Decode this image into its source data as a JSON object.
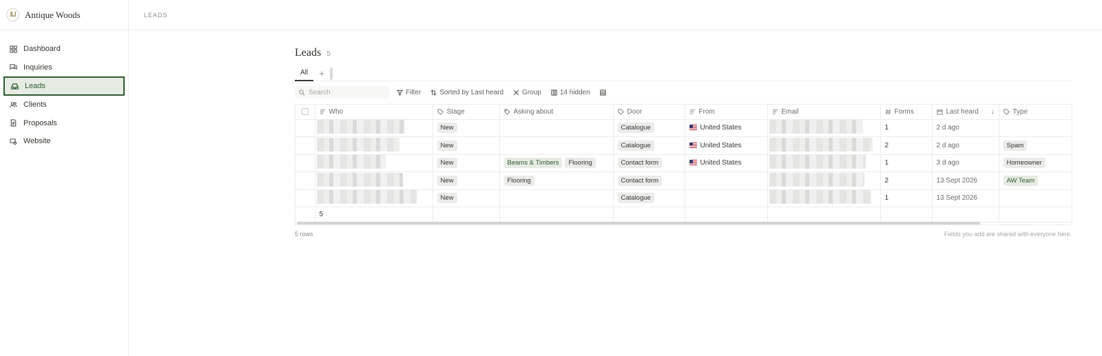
{
  "brand": {
    "logo_text": "IᏓI",
    "name": "Antique Woods"
  },
  "sidebar": {
    "items": [
      {
        "label": "Dashboard",
        "icon": "grid-icon"
      },
      {
        "label": "Inquiries",
        "icon": "chat-icon"
      },
      {
        "label": "Leads",
        "icon": "inbox-icon",
        "active": true
      },
      {
        "label": "Clients",
        "icon": "users-icon"
      },
      {
        "label": "Proposals",
        "icon": "document-icon"
      },
      {
        "label": "Website",
        "icon": "browser-icon"
      }
    ]
  },
  "topbar": {
    "breadcrumb": "LEADS"
  },
  "page": {
    "title": "Leads",
    "count": "5"
  },
  "views": {
    "tabs": [
      {
        "label": "All",
        "active": true
      }
    ],
    "add_label": "+"
  },
  "toolbar": {
    "search_placeholder": "Search",
    "filter_label": "Filter",
    "sort_label": "Sorted by Last heard",
    "group_label": "Group",
    "hidden_label": "14 hidden"
  },
  "table": {
    "columns": [
      "Who",
      "Stage",
      "Asking about",
      "Door",
      "From",
      "Email",
      "Forms",
      "Last heard",
      "Type"
    ],
    "rows": [
      {
        "stage": "New",
        "asking": [],
        "door": "Catalogue",
        "from": "United States",
        "forms": "1",
        "last_heard": "2 d ago",
        "type": ""
      },
      {
        "stage": "New",
        "asking": [],
        "door": "Catalogue",
        "from": "United States",
        "forms": "2",
        "last_heard": "2 d ago",
        "type": "Spam"
      },
      {
        "stage": "New",
        "asking": [
          "Beams & Timbers",
          "Flooring"
        ],
        "door": "Contact form",
        "from": "United States",
        "forms": "1",
        "last_heard": "3 d ago",
        "type": "Homeowner"
      },
      {
        "stage": "New",
        "asking": [
          "Flooring"
        ],
        "door": "Contact form",
        "from": "",
        "forms": "2",
        "last_heard": "13 Sept 2026",
        "type": "AW Team"
      },
      {
        "stage": "New",
        "asking": [],
        "door": "Catalogue",
        "from": "",
        "forms": "1",
        "last_heard": "13 Sept 2026",
        "type": ""
      }
    ],
    "footer_count": "5"
  },
  "status": {
    "rows_label": "5 rows",
    "note": "Fields you add are shared with everyone here."
  }
}
